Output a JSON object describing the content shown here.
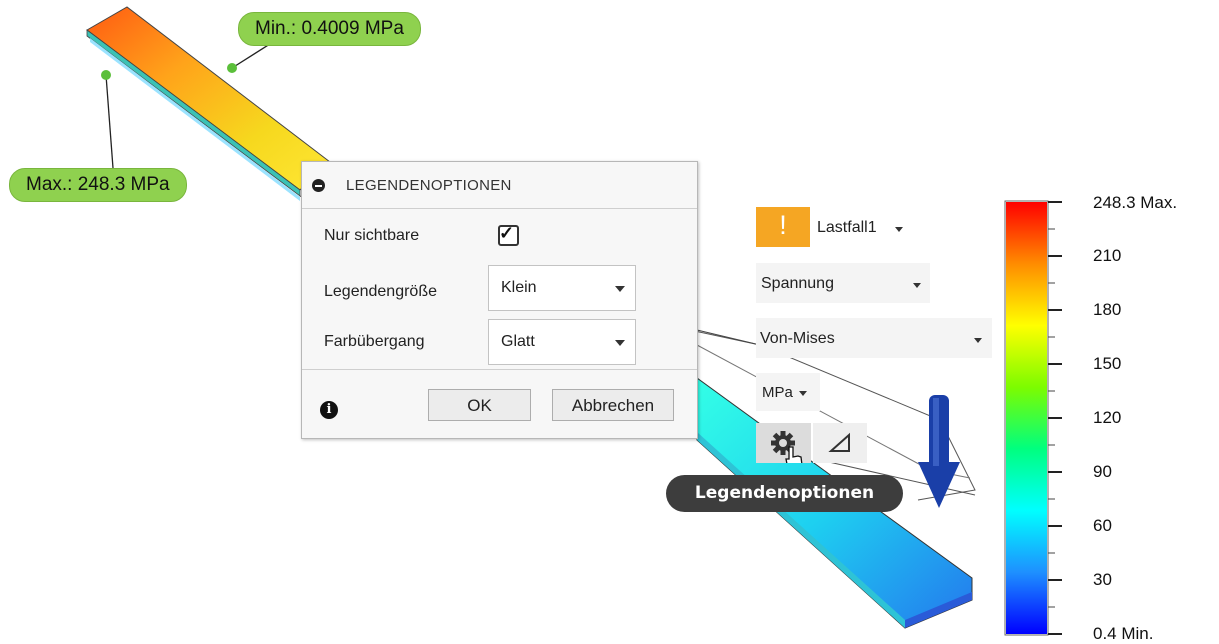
{
  "callouts": {
    "min": "Min.: 0.4009 MPa",
    "max": "Max.: 248.3 MPa"
  },
  "dialog": {
    "title": "LEGENDENOPTIONEN",
    "only_visible_label": "Nur sichtbare",
    "only_visible_checked": true,
    "legend_size_label": "Legendengröße",
    "legend_size_value": "Klein",
    "color_transition_label": "Farbübergang",
    "color_transition_value": "Glatt",
    "ok_label": "OK",
    "cancel_label": "Abbrechen"
  },
  "toolbar": {
    "warning_icon": "exclamation-icon",
    "warning_color": "#f5a623",
    "load_case": "Lastfall1",
    "result_type": "Spannung",
    "component": "Von-Mises",
    "unit": "MPa",
    "legend_options_icon": "gear-icon",
    "probe_icon": "triangle-icon"
  },
  "tooltip": "Legendenoptionen",
  "legend": {
    "max_label": "248.3 Max.",
    "min_label": "0.4 Min.",
    "ticks": [
      "210",
      "180",
      "150",
      "120",
      "90",
      "60",
      "30"
    ],
    "gradient_colors": [
      "#ff0000",
      "#ff8c00",
      "#ffff00",
      "#7cfc00",
      "#00ff7f",
      "#00ffff",
      "#1e90ff",
      "#0000ff"
    ]
  },
  "load_arrow_color": "#1a3fa8"
}
